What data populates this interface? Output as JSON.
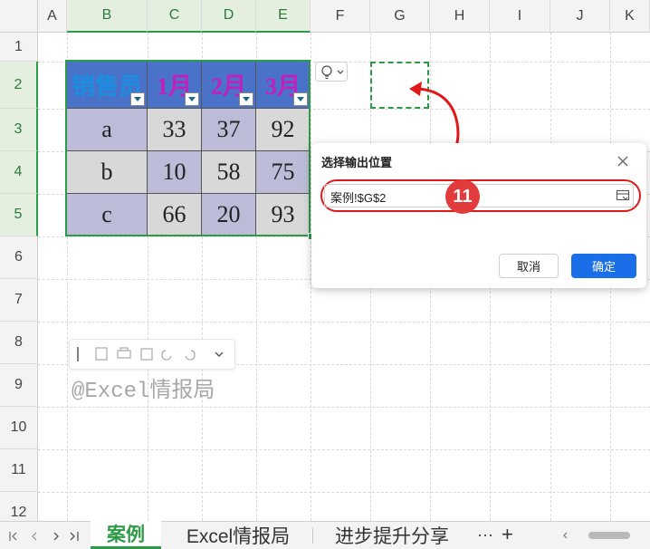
{
  "columns": [
    "A",
    "B",
    "C",
    "D",
    "E",
    "F",
    "G",
    "H",
    "I",
    "J",
    "K"
  ],
  "rows": [
    "1",
    "2",
    "3",
    "4",
    "5",
    "6",
    "7",
    "8",
    "9",
    "10",
    "11",
    "12"
  ],
  "table": {
    "headers": [
      "销售员",
      "1月",
      "2月",
      "3月"
    ],
    "data": [
      [
        "a",
        "33",
        "37",
        "92"
      ],
      [
        "b",
        "10",
        "58",
        "75"
      ],
      [
        "c",
        "66",
        "20",
        "93"
      ]
    ]
  },
  "dialog": {
    "title": "选择输出位置",
    "input_value": "案例!$G$2",
    "cancel": "取消",
    "ok": "确定"
  },
  "badge": "11",
  "watermark": "@Excel情报局",
  "tabs": [
    "案例",
    "Excel情报局",
    "进步提升分享"
  ],
  "tabs_more": "···",
  "tabs_add": "+",
  "colors": {
    "accent": "#2e9a47",
    "header_fill": "#4a72c8",
    "header_text_name": "#1a8ee0",
    "header_text_month": "#c020c0",
    "badge": "#e23b3b",
    "arrow": "#e01818",
    "primary_button": "#1a6fe8"
  }
}
